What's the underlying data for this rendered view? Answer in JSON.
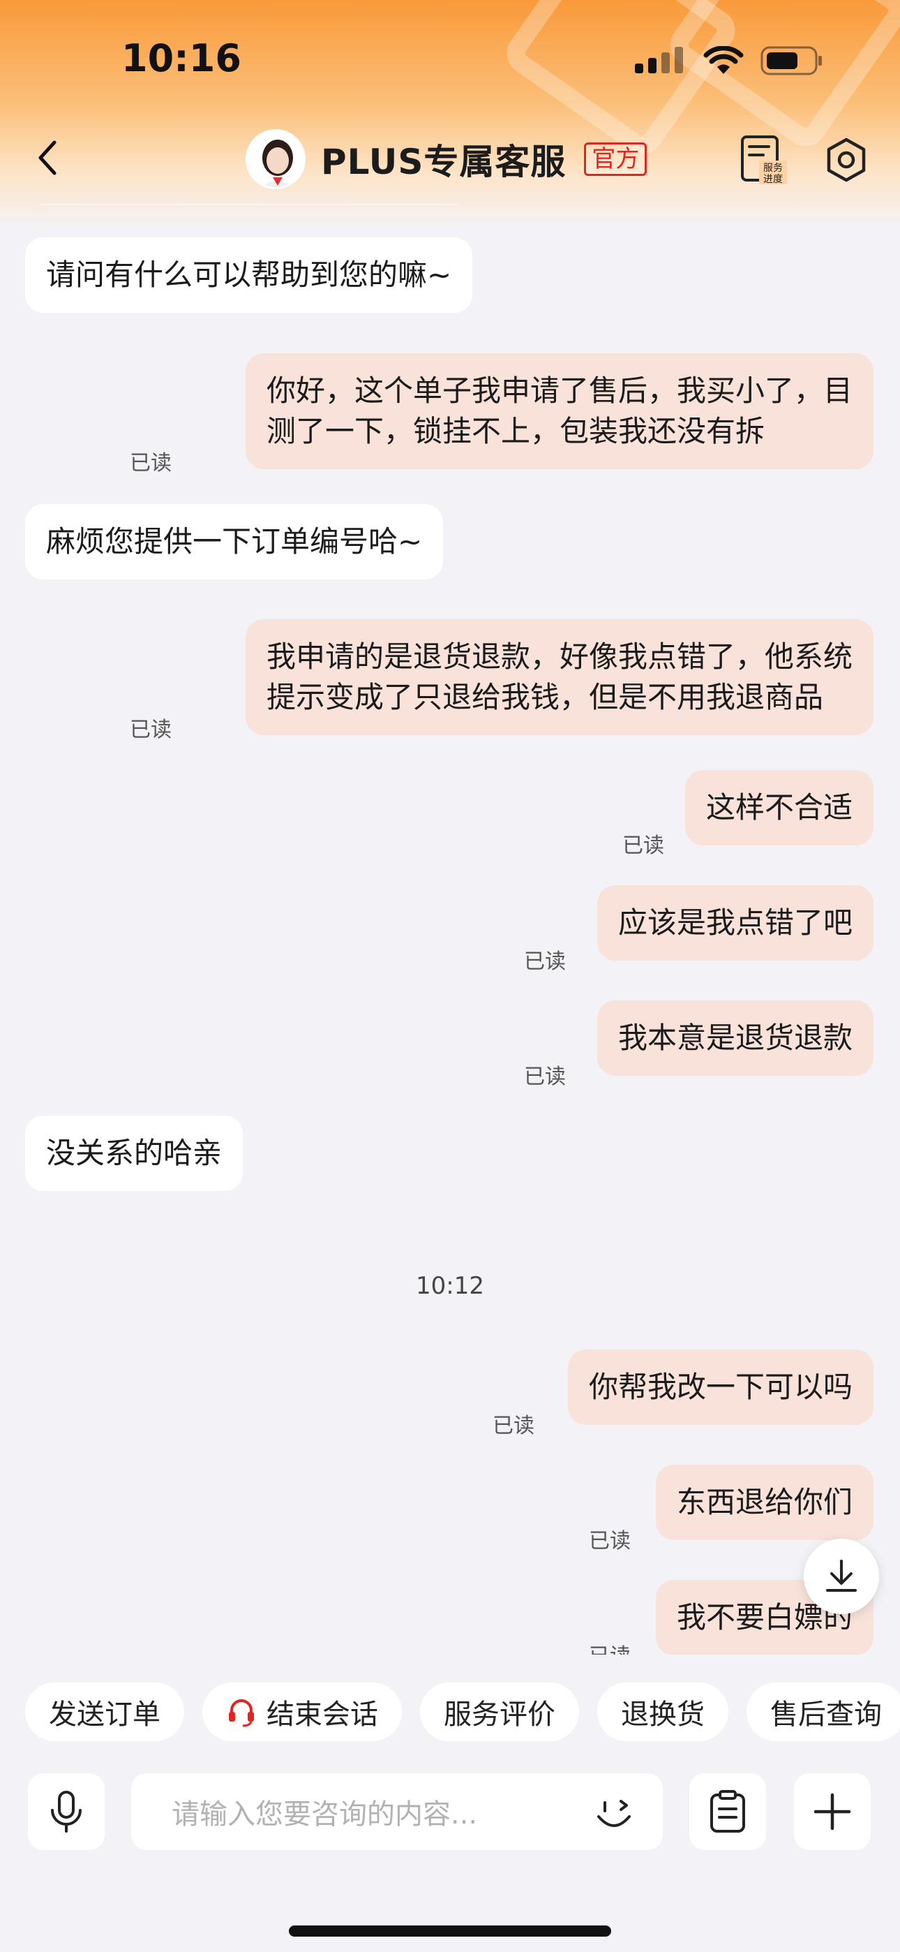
{
  "status_bar": {
    "time": "10:16"
  },
  "header": {
    "title": "PLUS专属客服",
    "badge": "官方",
    "progress_icon_text_1": "服务",
    "progress_icon_text_2": "进度"
  },
  "messages": [
    {
      "side": "left",
      "text": "请问有什么可以帮助到您的嘛~"
    },
    {
      "side": "right",
      "text": "你好，这个单子我申请了售后，我买小了，目\n测了一下，锁挂不上，包装我还没有拆",
      "status": "已读"
    },
    {
      "side": "left",
      "text": "麻烦您提供一下订单编号哈~"
    },
    {
      "side": "right",
      "text": "我申请的是退货退款，好像我点错了，他系统\n提示变成了只退给我钱，但是不用我退商品",
      "status": "已读"
    },
    {
      "side": "right",
      "text": "这样不合适",
      "status": "已读"
    },
    {
      "side": "right",
      "text": "应该是我点错了吧",
      "status": "已读"
    },
    {
      "side": "right",
      "text": "我本意是退货退款",
      "status": "已读"
    },
    {
      "side": "left",
      "text": "没关系的哈亲"
    },
    {
      "timestamp": "10:12"
    },
    {
      "side": "right",
      "text": "你帮我改一下可以吗",
      "status": "已读"
    },
    {
      "side": "right",
      "text": "东西退给你们",
      "status": "已读"
    },
    {
      "side": "right",
      "text": "我不要白嫖的",
      "status": "已读"
    }
  ],
  "quick_actions": [
    "发送订单",
    "结束会话",
    "服务评价",
    "退换货",
    "售后查询"
  ],
  "input": {
    "placeholder": "请输入您要咨询的内容..."
  },
  "colors": {
    "accent": "#f99a3a",
    "official_red": "#e3241f",
    "bubble_right": "#f8e2da"
  }
}
